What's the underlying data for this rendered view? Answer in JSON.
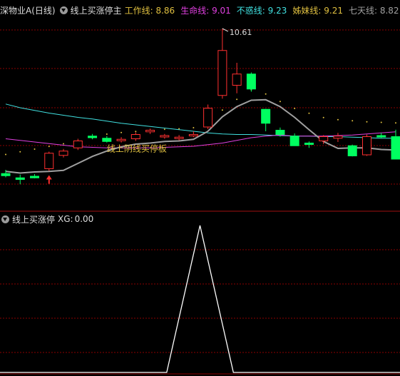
{
  "colors": {
    "background": "#000000",
    "grid": "#8b0000",
    "up_candle": "#ff3030",
    "down_candle": "#00ff60",
    "ma_work": "#a0a0a0",
    "ma_life": "#e040e0",
    "ma_buhuo": "#40e0e0",
    "ma_sister": "#e0c040",
    "ma_seven": "#a0a0a0",
    "signal_line": "#ffffff",
    "annotation": "#e0c040"
  },
  "header": {
    "stock_name": "深物业A(日线)",
    "indicator_name": "线上买涨停主",
    "lines": [
      {
        "label": "工作线:",
        "value": "8.86",
        "color": "#e0c040"
      },
      {
        "label": "生命线:",
        "value": "9.01",
        "color": "#e040e0"
      },
      {
        "label": "不惑线:",
        "value": "9.23",
        "color": "#40e0e0"
      },
      {
        "label": "姊妹线:",
        "value": "9.21",
        "color": "#e0c040"
      },
      {
        "label": "七天线:",
        "value": "8.82",
        "color": "#a0a0a0"
      }
    ]
  },
  "sub_header": {
    "indicator_name": "线上买涨停",
    "field_label": "XG:",
    "field_value": "0.00"
  },
  "chart_data": [
    {
      "type": "candlestick",
      "title": "线上买涨停主",
      "annotation": "线上阴线买停板",
      "max_label": "10.61",
      "ylim": [
        7.25,
        10.85
      ],
      "candles": [
        {
          "o": 7.9,
          "h": 7.97,
          "l": 7.83,
          "c": 7.86
        },
        {
          "o": 7.82,
          "h": 7.88,
          "l": 7.7,
          "c": 7.79
        },
        {
          "o": 7.85,
          "h": 7.89,
          "l": 7.81,
          "c": 7.82
        },
        {
          "o": 7.99,
          "h": 8.31,
          "l": 7.95,
          "c": 8.28
        },
        {
          "o": 8.24,
          "h": 8.36,
          "l": 8.2,
          "c": 8.32
        },
        {
          "o": 8.38,
          "h": 8.55,
          "l": 8.34,
          "c": 8.51
        },
        {
          "o": 8.6,
          "h": 8.64,
          "l": 8.54,
          "c": 8.57
        },
        {
          "o": 8.56,
          "h": 8.6,
          "l": 8.48,
          "c": 8.5
        },
        {
          "o": 8.52,
          "h": 8.58,
          "l": 8.48,
          "c": 8.54
        },
        {
          "o": 8.55,
          "h": 8.67,
          "l": 8.51,
          "c": 8.63
        },
        {
          "o": 8.68,
          "h": 8.74,
          "l": 8.64,
          "c": 8.71
        },
        {
          "o": 8.59,
          "h": 8.64,
          "l": 8.55,
          "c": 8.61
        },
        {
          "o": 8.56,
          "h": 8.62,
          "l": 8.52,
          "c": 8.58
        },
        {
          "o": 8.62,
          "h": 8.69,
          "l": 8.58,
          "c": 8.63
        },
        {
          "o": 8.77,
          "h": 9.19,
          "l": 8.73,
          "c": 9.12
        },
        {
          "o": 9.36,
          "h": 10.61,
          "l": 9.3,
          "c": 10.2
        },
        {
          "o": 9.55,
          "h": 9.97,
          "l": 9.4,
          "c": 9.76
        },
        {
          "o": 9.76,
          "h": 9.79,
          "l": 9.43,
          "c": 9.48
        },
        {
          "o": 9.1,
          "h": 9.11,
          "l": 8.69,
          "c": 8.84
        },
        {
          "o": 8.71,
          "h": 8.76,
          "l": 8.59,
          "c": 8.63
        },
        {
          "o": 8.6,
          "h": 8.65,
          "l": 8.43,
          "c": 8.42
        },
        {
          "o": 8.47,
          "h": 8.5,
          "l": 8.38,
          "c": 8.46
        },
        {
          "o": 8.51,
          "h": 8.62,
          "l": 8.45,
          "c": 8.59
        },
        {
          "o": 8.56,
          "h": 8.66,
          "l": 8.49,
          "c": 8.6
        },
        {
          "o": 8.42,
          "h": 8.44,
          "l": 8.22,
          "c": 8.23
        },
        {
          "o": 8.25,
          "h": 8.63,
          "l": 8.23,
          "c": 8.59
        },
        {
          "o": 8.61,
          "h": 8.66,
          "l": 8.56,
          "c": 8.59
        },
        {
          "o": 8.59,
          "h": 8.72,
          "l": 8.34,
          "c": 8.17
        }
      ],
      "work_line": [
        8.07,
        8.12,
        8.17,
        8.22,
        8.27,
        8.32,
        8.38,
        8.45,
        8.48,
        8.5,
        8.52,
        8.54,
        8.55,
        8.57,
        8.72,
        8.9,
        9.1,
        9.28,
        9.2,
        9.06,
        8.93,
        8.84,
        8.76,
        8.72,
        8.7,
        8.68,
        8.67,
        8.66
      ],
      "seven_line": [
        7.94,
        7.91,
        7.93,
        7.94,
        7.96,
        8.09,
        8.22,
        8.32,
        8.4,
        8.45,
        8.47,
        8.5,
        8.51,
        8.54,
        8.69,
        8.96,
        9.15,
        9.27,
        9.28,
        9.15,
        8.95,
        8.72,
        8.5,
        8.37,
        8.38,
        8.38,
        8.35,
        8.34
      ],
      "life_line": [
        8.55,
        8.52,
        8.49,
        8.46,
        8.43,
        8.4,
        8.39,
        8.38,
        8.38,
        8.38,
        8.38,
        8.39,
        8.4,
        8.41,
        8.44,
        8.47,
        8.52,
        8.57,
        8.6,
        8.62,
        8.6,
        8.6,
        8.6,
        8.61,
        8.62,
        8.64,
        8.66,
        8.68
      ],
      "buhuo_line": [
        9.2,
        9.13,
        9.08,
        9.03,
        8.99,
        8.95,
        8.92,
        8.88,
        8.84,
        8.81,
        8.78,
        8.75,
        8.72,
        8.69,
        8.66,
        8.64,
        8.63,
        8.63,
        8.62,
        8.61,
        8.6,
        8.6,
        8.59,
        8.59,
        8.58,
        8.57,
        8.56,
        8.56
      ],
      "arrow_at_index": 3
    },
    {
      "type": "line",
      "title": "线上买涨停",
      "series": [
        {
          "name": "XG",
          "x": [
            0,
            1,
            2,
            3,
            4,
            5,
            6,
            7,
            8,
            9,
            10,
            11,
            12
          ],
          "values": [
            0,
            0,
            0,
            0,
            0,
            0,
            1,
            0,
            0,
            0,
            0,
            0,
            0
          ]
        }
      ],
      "ylim": [
        0,
        1
      ],
      "xlim": [
        0,
        12
      ]
    }
  ]
}
